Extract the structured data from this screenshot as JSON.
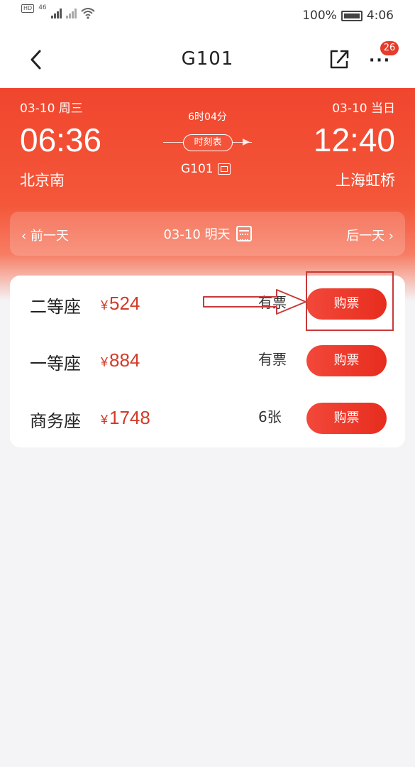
{
  "status_bar": {
    "network_label": "HD",
    "network_sub": "46",
    "battery_text": "100%",
    "time": "4:06"
  },
  "nav": {
    "title": "G101",
    "badge_count": "26"
  },
  "trip": {
    "depart_date": "03-10 周三",
    "arrive_date": "03-10 当日",
    "depart_time": "06:36",
    "arrive_time": "12:40",
    "depart_station": "北京南",
    "arrive_station": "上海虹桥",
    "duration": "6时04分",
    "timetable_label": "时刻表",
    "train_number": "G101"
  },
  "date_bar": {
    "prev_label": "‹ 前一天",
    "current_label": "03-10 明天",
    "next_label": "后一天 ›"
  },
  "seats": [
    {
      "name": "二等座",
      "currency": "¥",
      "price": "524",
      "availability": "有票",
      "buy_label": "购票"
    },
    {
      "name": "一等座",
      "currency": "¥",
      "price": "884",
      "availability": "有票",
      "buy_label": "购票"
    },
    {
      "name": "商务座",
      "currency": "¥",
      "price": "1748",
      "availability": "6张",
      "buy_label": "购票"
    }
  ],
  "colors": {
    "brand_red": "#f0462e",
    "price_red": "#d23b27",
    "button_red": "#e72d1e"
  }
}
